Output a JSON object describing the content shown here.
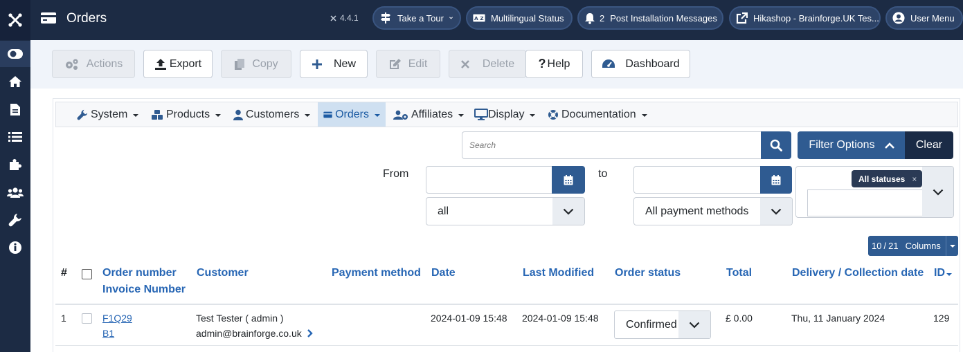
{
  "header": {
    "title": "Orders",
    "version": "4.4.1",
    "pills": [
      {
        "label": "Take a Tour",
        "icon": "signpost-icon"
      },
      {
        "label": "Multilingual Status",
        "icon": "language-icon"
      },
      {
        "label": "Post Installation Messages",
        "icon": "bell-icon",
        "count": "2"
      },
      {
        "label": "Hikashop - Brainforge.UK Tes...",
        "icon": "external-link-icon"
      },
      {
        "label": "User Menu",
        "icon": "user-icon"
      }
    ]
  },
  "toolbar": {
    "actions": "Actions",
    "export": "Export",
    "copy": "Copy",
    "new": "New",
    "edit": "Edit",
    "delete": "Delete",
    "help": "Help",
    "dashboard": "Dashboard"
  },
  "menu": {
    "system": "System",
    "products": "Products",
    "customers": "Customers",
    "orders": "Orders",
    "affiliates": "Affiliates",
    "display": "Display",
    "documentation": "Documentation"
  },
  "search": {
    "placeholder": "Search",
    "filter_options": "Filter Options",
    "clear": "Clear"
  },
  "filters": {
    "from_label": "From",
    "to_label": "to",
    "type_select": "all",
    "payment_select": "All payment methods",
    "status_tag": "All statuses",
    "status_tag_remove": "×"
  },
  "columns_button": {
    "shown": "10",
    "separator": "/",
    "total": "21",
    "label": "Columns"
  },
  "table": {
    "headers": {
      "num": "#",
      "order_number": "Order number",
      "invoice_number": "Invoice Number",
      "customer": "Customer",
      "payment_method": "Payment method",
      "date": "Date",
      "last_modified": "Last Modified",
      "order_status": "Order status",
      "total": "Total",
      "delivery": "Delivery / Collection date",
      "id": "ID"
    },
    "rows": [
      {
        "num": "1",
        "order_number": "F1Q29",
        "invoice_number": "B1",
        "customer_name": "Test Tester ( admin )",
        "customer_email": "admin@brainforge.co.uk",
        "payment_method": "",
        "date": "2024-01-09 15:48",
        "last_modified": "2024-01-09 15:48",
        "order_status": "Confirmed",
        "total": "£ 0.00",
        "delivery": "Thu, 11 January 2024",
        "id": "129"
      }
    ]
  },
  "colors": {
    "sidebar": "#1c2b44",
    "primary": "#2f5b91",
    "link": "#2766b4",
    "dark": "#1a2b46"
  }
}
